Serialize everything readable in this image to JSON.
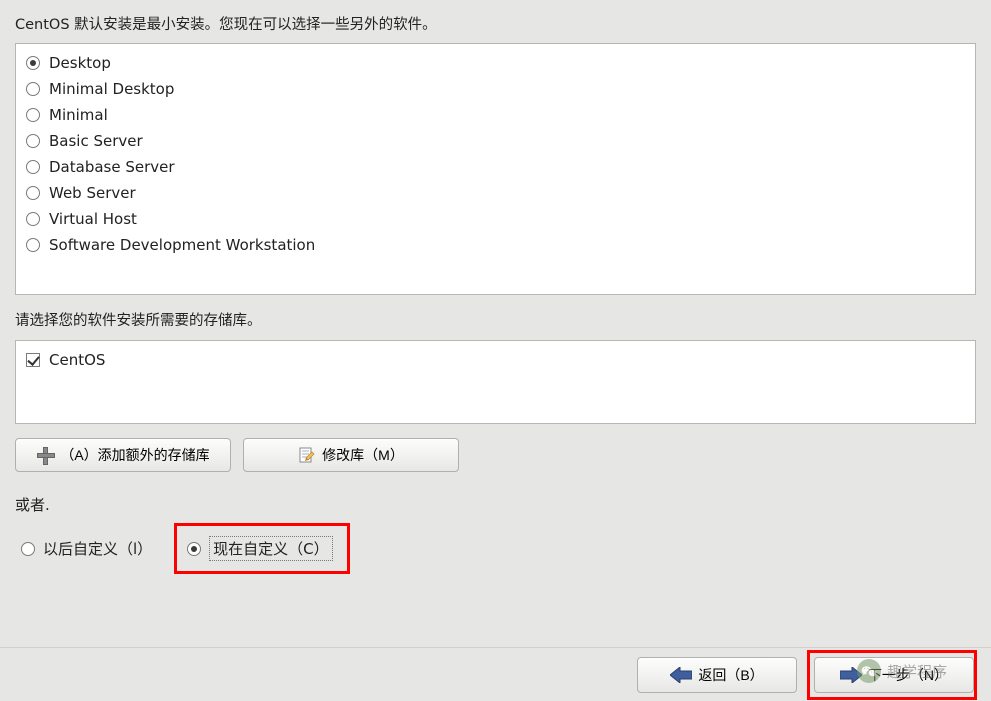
{
  "description": "CentOS 默认安装是最小安装。您现在可以选择一些另外的软件。",
  "softwareOptions": [
    {
      "label": "Desktop",
      "selected": true
    },
    {
      "label": "Minimal Desktop",
      "selected": false
    },
    {
      "label": "Minimal",
      "selected": false
    },
    {
      "label": "Basic Server",
      "selected": false
    },
    {
      "label": "Database Server",
      "selected": false
    },
    {
      "label": "Web Server",
      "selected": false
    },
    {
      "label": "Virtual Host",
      "selected": false
    },
    {
      "label": "Software Development Workstation",
      "selected": false
    }
  ],
  "repoPrompt": "请选择您的软件安装所需要的存储库。",
  "repos": [
    {
      "label": "CentOS",
      "checked": true
    }
  ],
  "buttons": {
    "addRepo": "（A）添加额外的存储库",
    "editRepo": "修改库（M）"
  },
  "orLabel": "或者.",
  "customize": {
    "later": "以后自定义（l）",
    "now": "现在自定义（C）",
    "selected": "now"
  },
  "footer": {
    "back": "返回（B）",
    "next": "下一步（N）"
  },
  "watermark": "趣学程序"
}
